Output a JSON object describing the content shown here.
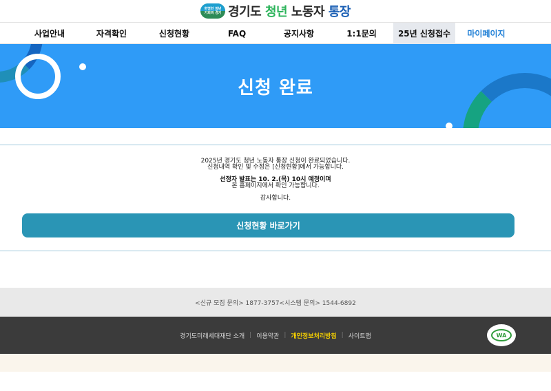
{
  "header": {
    "logo_badge": "현명한 청년 기회의 경기",
    "logo_parts": [
      "경기도 ",
      "청년",
      " 노동자 ",
      "통장"
    ]
  },
  "nav": {
    "items": [
      {
        "label": "사업안내"
      },
      {
        "label": "자격확인"
      },
      {
        "label": "신청현황"
      },
      {
        "label": "FAQ"
      },
      {
        "label": "공지사항"
      },
      {
        "label": "1:1문의"
      },
      {
        "label": "25년 신청접수"
      },
      {
        "label": "마이페이지"
      }
    ],
    "active_label": "25년 신청접수"
  },
  "banner": {
    "title": "신청 완료"
  },
  "message": {
    "line1": "2025년 경기도 청년 노동자 통장 신청이 완료되었습니다.",
    "line2": "신청내역 확인 및 수정은 [신청현황]에서 가능합니다.",
    "line3": "선정자 발표는 10. 2.(목) 10시 예정이며",
    "line4": "본 홈페이지에서 확인 가능합니다.",
    "line5": "감사합니다."
  },
  "cta": {
    "label": "신청현황 바로가기"
  },
  "footer": {
    "contact": "<신규 모집 문의> 1877-3757<시스템 문의> 1544-6892",
    "links": [
      {
        "label": "경기도미래세대재단 소개",
        "highlight": false
      },
      {
        "label": "이용약관",
        "highlight": false
      },
      {
        "label": "개인정보처리방침",
        "highlight": true
      },
      {
        "label": "사이트맵",
        "highlight": false
      }
    ],
    "wa_mark": "WA"
  },
  "colors": {
    "banner": "#2f9bf7",
    "cta": "#2a95b5",
    "mypage": "#1f7fd6",
    "highlight_link": "#f5d000"
  }
}
